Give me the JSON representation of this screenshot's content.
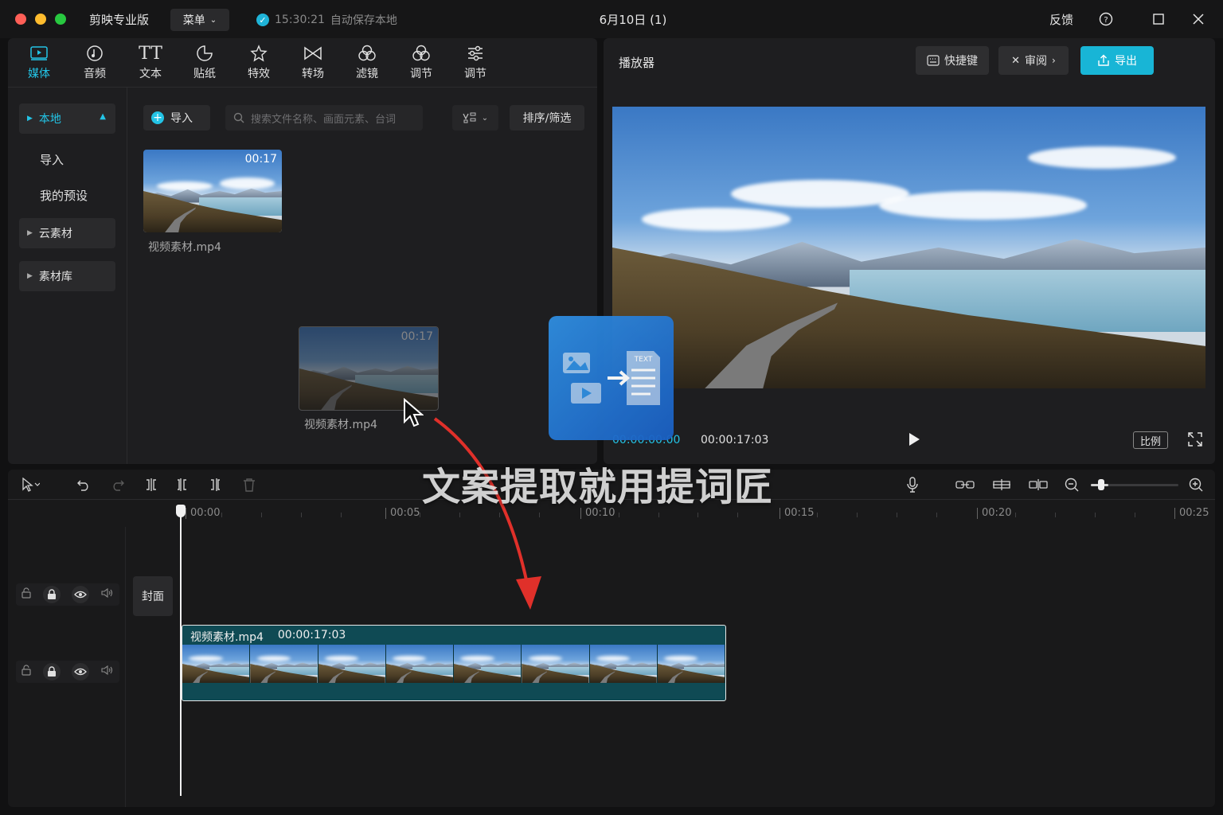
{
  "titlebar": {
    "app_name": "剪映专业版",
    "menu_label": "菜单",
    "autosave_time": "15:30:21",
    "autosave_text": "自动保存本地",
    "doc_title": "6月10日 (1)",
    "feedback": "反馈"
  },
  "tabs": [
    {
      "label": "媒体",
      "icon": "media-icon",
      "active": true
    },
    {
      "label": "音频",
      "icon": "audio-icon"
    },
    {
      "label": "文本",
      "icon": "text-icon"
    },
    {
      "label": "贴纸",
      "icon": "sticker-icon"
    },
    {
      "label": "特效",
      "icon": "effects-icon"
    },
    {
      "label": "转场",
      "icon": "transition-icon"
    },
    {
      "label": "滤镜",
      "icon": "filter-icon"
    },
    {
      "label": "调节",
      "icon": "adjust-icon"
    },
    {
      "label": "调节",
      "icon": "sliders-icon"
    }
  ],
  "sidebar": {
    "local": "本地",
    "import": "导入",
    "presets": "我的预设",
    "cloud": "云素材",
    "library": "素材库"
  },
  "media": {
    "import_button": "导入",
    "search_placeholder": "搜索文件名称、画面元素、台词",
    "sort_filter": "排序/筛选",
    "file_name": "视频素材.mp4",
    "file_duration": "00:17"
  },
  "player": {
    "title": "播放器",
    "shortcuts": "快捷键",
    "review": "审阅",
    "export": "导出",
    "current_time": "00:00:00:00",
    "total_time": "00:00:17:03",
    "ratio": "比例"
  },
  "timeline": {
    "ticks": [
      "00:00",
      "00:05",
      "00:10",
      "00:15",
      "00:20",
      "00:25"
    ],
    "cover": "封面",
    "clip_name": "视频素材.mp4",
    "clip_duration": "00:00:17:03"
  },
  "overlay": {
    "caption": "文案提取就用提词匠",
    "logo_text": "TEXT"
  },
  "colors": {
    "accent": "#23c4e6",
    "export": "#18b5d6",
    "clip_bg": "#0f4a54",
    "arrow": "#e0302a"
  }
}
